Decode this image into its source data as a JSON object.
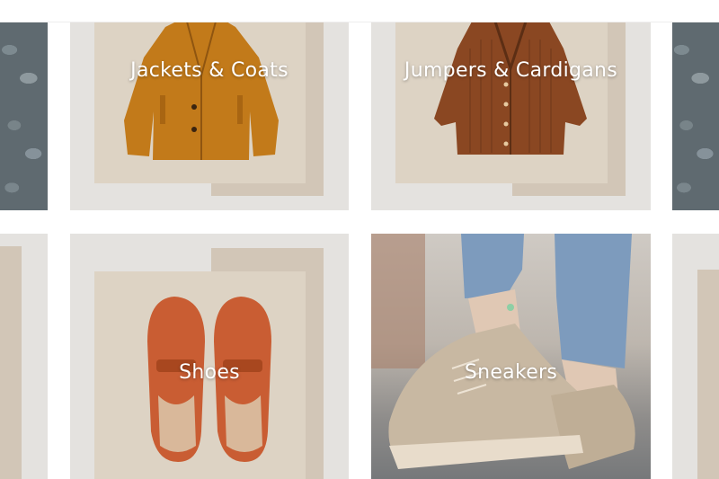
{
  "categories": [
    {
      "label": "Jackets & Coats"
    },
    {
      "label": "Jumpers & Cardigans"
    },
    {
      "label": "Shoes"
    },
    {
      "label": "Sneakers"
    }
  ],
  "colors": {
    "frame": "#e4e2df",
    "card_back": "#d2c6b7",
    "card_front": "#ddd3c4",
    "coat": "#c27a1a",
    "cardigan": "#8a4722",
    "loafer": "#c95d33",
    "sneaker": "#c8b8a2",
    "jeans": "#7d9bbd"
  },
  "images": {
    "jackets": "mustard-coat",
    "jumpers": "brown-cardigan",
    "shoes": "orange-loafers",
    "sneakers": "beige-sneakers"
  }
}
